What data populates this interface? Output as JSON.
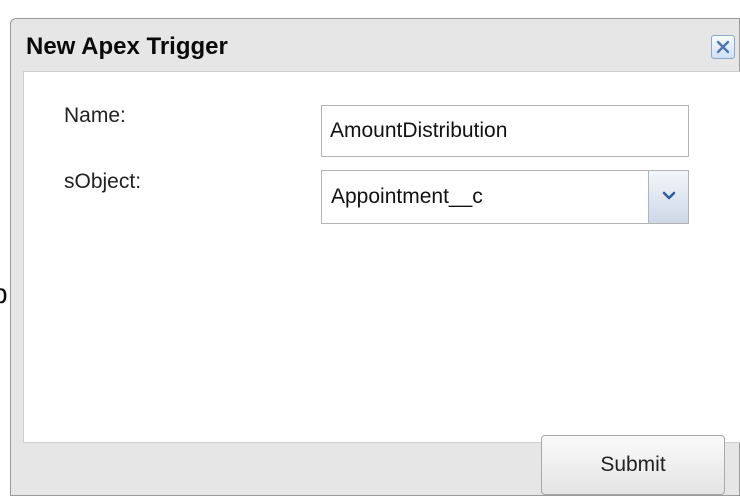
{
  "background": {
    "partial_glyph": "b"
  },
  "dialog": {
    "title": "New Apex Trigger",
    "close_icon": "close-icon",
    "fields": {
      "name_label": "Name:",
      "name_value": "AmountDistribution",
      "sobject_label": "sObject:",
      "sobject_value": "Appointment__c",
      "dropdown_icon": "chevron-down-icon"
    },
    "submit_label": "Submit"
  },
  "colors": {
    "dialog_bg": "#e6e6e6",
    "panel_bg": "#ffffff",
    "accent_blue": "#4a78b0"
  }
}
